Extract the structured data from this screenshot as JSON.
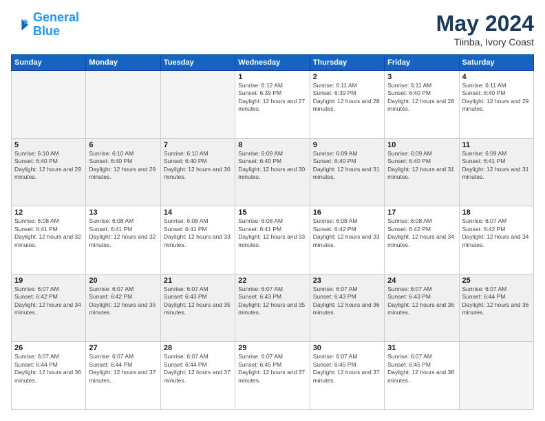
{
  "logo": {
    "line1": "General",
    "line2": "Blue"
  },
  "header": {
    "month_year": "May 2024",
    "location": "Tiinba, Ivory Coast"
  },
  "weekdays": [
    "Sunday",
    "Monday",
    "Tuesday",
    "Wednesday",
    "Thursday",
    "Friday",
    "Saturday"
  ],
  "weeks": [
    [
      {
        "day": "",
        "empty": true
      },
      {
        "day": "",
        "empty": true
      },
      {
        "day": "",
        "empty": true
      },
      {
        "day": "1",
        "sunrise": "6:12 AM",
        "sunset": "6:39 PM",
        "daylight": "12 hours and 27 minutes."
      },
      {
        "day": "2",
        "sunrise": "6:11 AM",
        "sunset": "6:39 PM",
        "daylight": "12 hours and 28 minutes."
      },
      {
        "day": "3",
        "sunrise": "6:11 AM",
        "sunset": "6:40 PM",
        "daylight": "12 hours and 28 minutes."
      },
      {
        "day": "4",
        "sunrise": "6:11 AM",
        "sunset": "6:40 PM",
        "daylight": "12 hours and 29 minutes."
      }
    ],
    [
      {
        "day": "5",
        "sunrise": "6:10 AM",
        "sunset": "6:40 PM",
        "daylight": "12 hours and 29 minutes."
      },
      {
        "day": "6",
        "sunrise": "6:10 AM",
        "sunset": "6:40 PM",
        "daylight": "12 hours and 29 minutes."
      },
      {
        "day": "7",
        "sunrise": "6:10 AM",
        "sunset": "6:40 PM",
        "daylight": "12 hours and 30 minutes."
      },
      {
        "day": "8",
        "sunrise": "6:09 AM",
        "sunset": "6:40 PM",
        "daylight": "12 hours and 30 minutes."
      },
      {
        "day": "9",
        "sunrise": "6:09 AM",
        "sunset": "6:40 PM",
        "daylight": "12 hours and 31 minutes."
      },
      {
        "day": "10",
        "sunrise": "6:09 AM",
        "sunset": "6:40 PM",
        "daylight": "12 hours and 31 minutes."
      },
      {
        "day": "11",
        "sunrise": "6:09 AM",
        "sunset": "6:41 PM",
        "daylight": "12 hours and 31 minutes."
      }
    ],
    [
      {
        "day": "12",
        "sunrise": "6:08 AM",
        "sunset": "6:41 PM",
        "daylight": "12 hours and 32 minutes."
      },
      {
        "day": "13",
        "sunrise": "6:08 AM",
        "sunset": "6:41 PM",
        "daylight": "12 hours and 32 minutes."
      },
      {
        "day": "14",
        "sunrise": "6:08 AM",
        "sunset": "6:41 PM",
        "daylight": "12 hours and 33 minutes."
      },
      {
        "day": "15",
        "sunrise": "6:08 AM",
        "sunset": "6:41 PM",
        "daylight": "12 hours and 33 minutes."
      },
      {
        "day": "16",
        "sunrise": "6:08 AM",
        "sunset": "6:42 PM",
        "daylight": "12 hours and 33 minutes."
      },
      {
        "day": "17",
        "sunrise": "6:08 AM",
        "sunset": "6:42 PM",
        "daylight": "12 hours and 34 minutes."
      },
      {
        "day": "18",
        "sunrise": "6:07 AM",
        "sunset": "6:42 PM",
        "daylight": "12 hours and 34 minutes."
      }
    ],
    [
      {
        "day": "19",
        "sunrise": "6:07 AM",
        "sunset": "6:42 PM",
        "daylight": "12 hours and 34 minutes."
      },
      {
        "day": "20",
        "sunrise": "6:07 AM",
        "sunset": "6:42 PM",
        "daylight": "12 hours and 35 minutes."
      },
      {
        "day": "21",
        "sunrise": "6:07 AM",
        "sunset": "6:43 PM",
        "daylight": "12 hours and 35 minutes."
      },
      {
        "day": "22",
        "sunrise": "6:07 AM",
        "sunset": "6:43 PM",
        "daylight": "12 hours and 35 minutes."
      },
      {
        "day": "23",
        "sunrise": "6:07 AM",
        "sunset": "6:43 PM",
        "daylight": "12 hours and 36 minutes."
      },
      {
        "day": "24",
        "sunrise": "6:07 AM",
        "sunset": "6:43 PM",
        "daylight": "12 hours and 36 minutes."
      },
      {
        "day": "25",
        "sunrise": "6:07 AM",
        "sunset": "6:44 PM",
        "daylight": "12 hours and 36 minutes."
      }
    ],
    [
      {
        "day": "26",
        "sunrise": "6:07 AM",
        "sunset": "6:44 PM",
        "daylight": "12 hours and 36 minutes."
      },
      {
        "day": "27",
        "sunrise": "6:07 AM",
        "sunset": "6:44 PM",
        "daylight": "12 hours and 37 minutes."
      },
      {
        "day": "28",
        "sunrise": "6:07 AM",
        "sunset": "6:44 PM",
        "daylight": "12 hours and 37 minutes."
      },
      {
        "day": "29",
        "sunrise": "6:07 AM",
        "sunset": "6:45 PM",
        "daylight": "12 hours and 37 minutes."
      },
      {
        "day": "30",
        "sunrise": "6:07 AM",
        "sunset": "6:45 PM",
        "daylight": "12 hours and 37 minutes."
      },
      {
        "day": "31",
        "sunrise": "6:07 AM",
        "sunset": "6:45 PM",
        "daylight": "12 hours and 38 minutes."
      },
      {
        "day": "",
        "empty": true
      }
    ]
  ],
  "labels": {
    "sunrise": "Sunrise:",
    "sunset": "Sunset:",
    "daylight": "Daylight:"
  }
}
